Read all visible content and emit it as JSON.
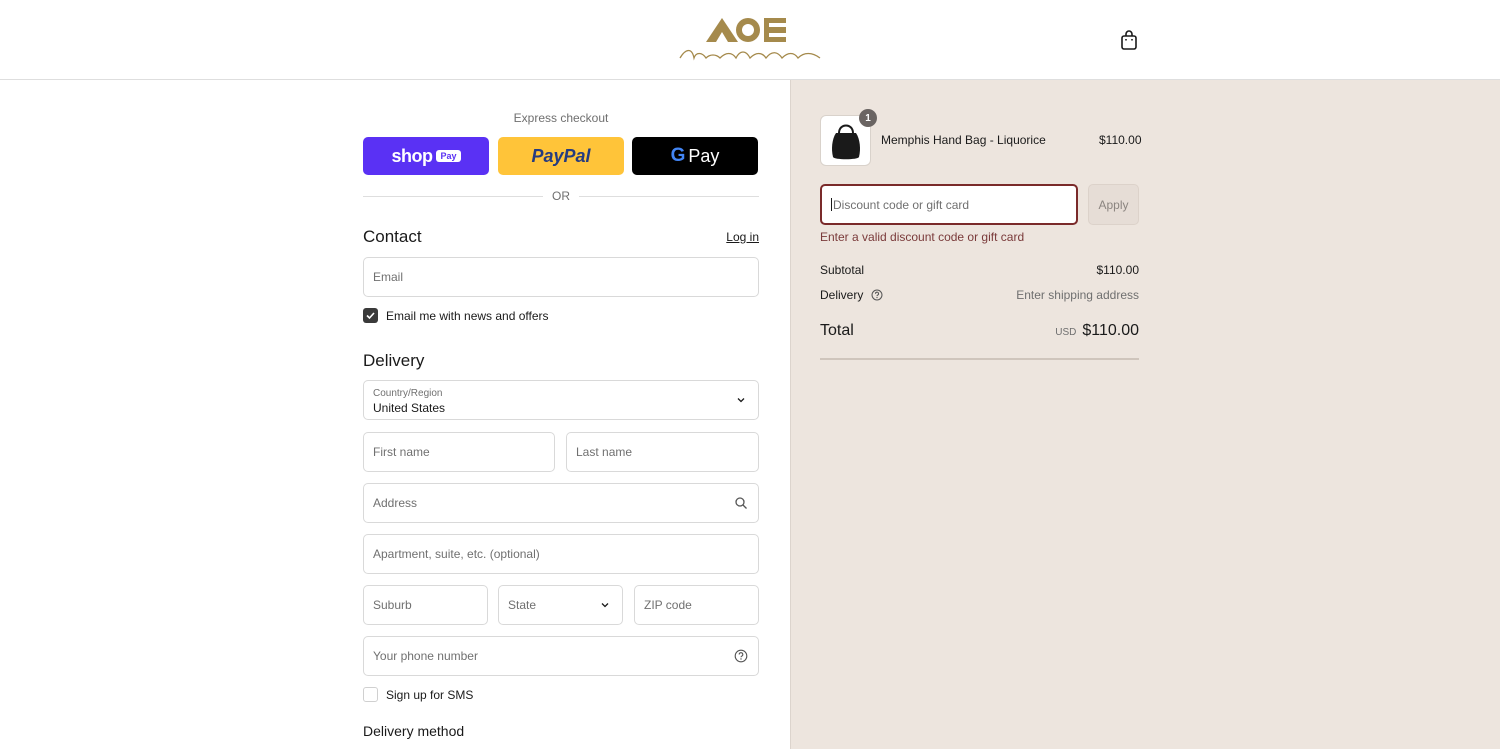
{
  "brand": {
    "logo_mark": "AOE",
    "logo_script": "Arms Of Eve",
    "cart_icon": "shopping-bag-icon"
  },
  "express": {
    "title": "Express checkout",
    "shop_pay": "shop",
    "shop_pay_badge": "Pay",
    "paypal": "PayPal",
    "gpay": "Pay",
    "or": "OR"
  },
  "contact": {
    "title": "Contact",
    "login": "Log in",
    "email_placeholder": "Email",
    "news_label": "Email me with news and offers",
    "news_checked": true
  },
  "delivery": {
    "title": "Delivery",
    "country_label": "Country/Region",
    "country_value": "United States",
    "first_name": "First name",
    "last_name": "Last name",
    "address": "Address",
    "apartment": "Apartment, suite, etc. (optional)",
    "suburb": "Suburb",
    "state": "State",
    "zip": "ZIP code",
    "phone": "Your phone number",
    "sms_label": "Sign up for SMS",
    "sms_checked": false,
    "method_title": "Delivery method"
  },
  "summary": {
    "item": {
      "name": "Memphis Hand Bag - Liquorice",
      "price": "$110.00",
      "qty": "1"
    },
    "discount_placeholder": "Discount code or gift card",
    "apply": "Apply",
    "discount_error": "Enter a valid discount code or gift card",
    "subtotal_label": "Subtotal",
    "subtotal_value": "$110.00",
    "delivery_label": "Delivery",
    "delivery_value": "Enter shipping address",
    "total_label": "Total",
    "total_currency": "USD",
    "total_value": "$110.00"
  },
  "colors": {
    "shop_pay": "#5a31f4",
    "paypal": "#ffc439",
    "gpay": "#000000",
    "summary_bg": "#ede5de",
    "brand_gold": "#a58a4c",
    "error": "#7a2a2a"
  }
}
